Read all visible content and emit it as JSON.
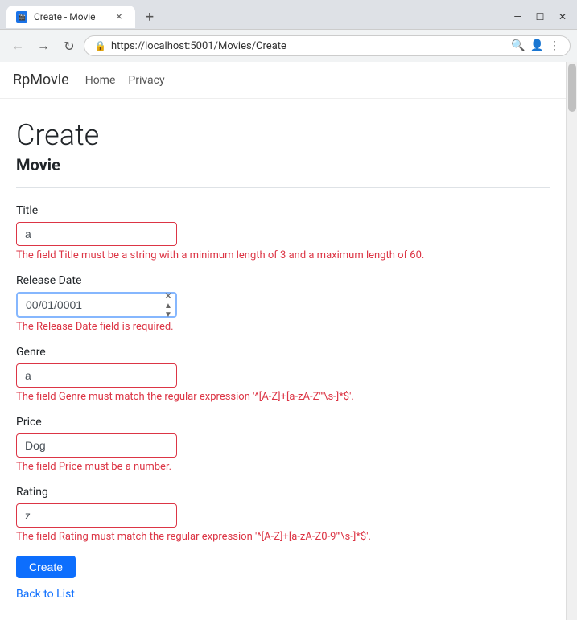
{
  "browser": {
    "tab": {
      "favicon": "🎬",
      "title": "Create - Movie",
      "close": "×"
    },
    "new_tab": "+",
    "window_controls": [
      "—",
      "☐",
      "×"
    ],
    "nav": {
      "back": "←",
      "forward": "→",
      "reload": "↻",
      "address": "https://localhost:5001/Movies/Create",
      "lock_icon": "🔒"
    }
  },
  "site": {
    "brand": "RpMovie",
    "nav_links": [
      "Home",
      "Privacy"
    ]
  },
  "page": {
    "title": "Create",
    "subtitle": "Movie"
  },
  "form": {
    "title_label": "Title",
    "title_value": "a",
    "title_error": "The field Title must be a string with a minimum length of 3 and a maximum length of 60.",
    "release_date_label": "Release Date",
    "release_date_value": "00/01/0001",
    "release_date_error": "The Release Date field is required.",
    "genre_label": "Genre",
    "genre_value": "a",
    "genre_error": "The field Genre must match the regular expression '^[A-Z]+[a-zA-Z\"'\\s-]*$'.",
    "price_label": "Price",
    "price_value": "Dog",
    "price_error": "The field Price must be a number.",
    "rating_label": "Rating",
    "rating_value": "z",
    "rating_error": "The field Rating must match the regular expression '^[A-Z]+[a-zA-Z0-9\"'\\s-]*$'.",
    "submit_label": "Create",
    "back_link": "Back to List"
  },
  "scrollbar": {
    "visible": true
  }
}
